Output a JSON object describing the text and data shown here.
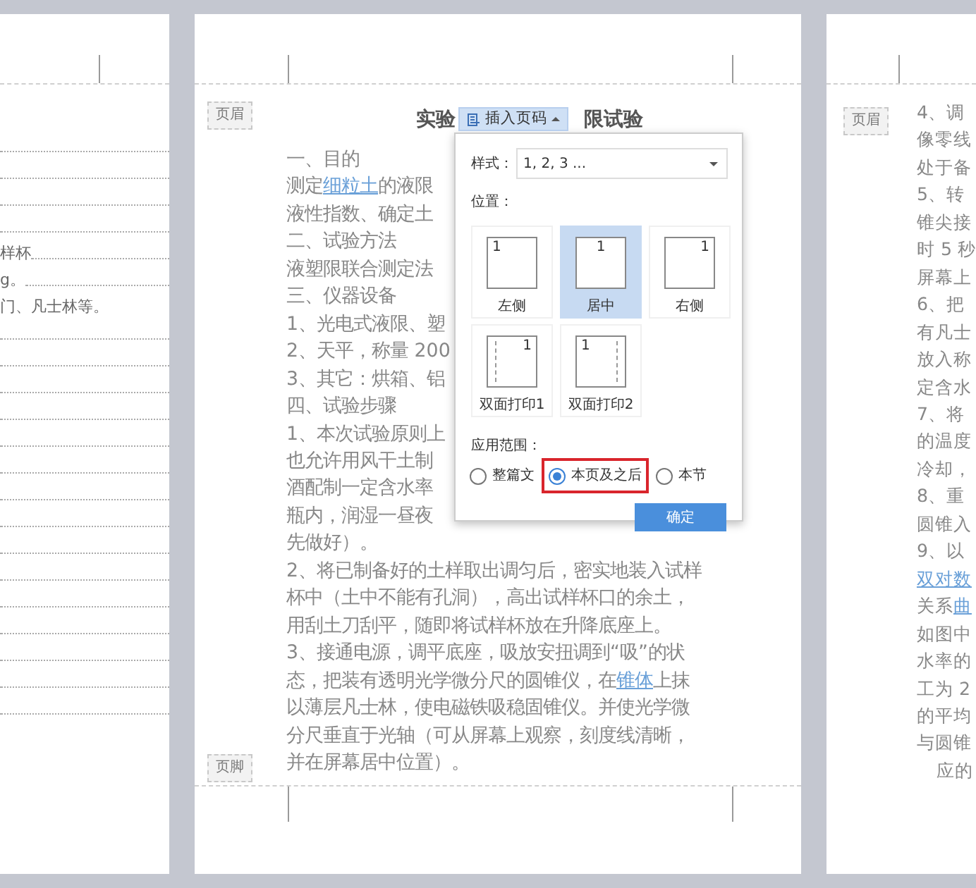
{
  "left_page": {
    "rows": [
      {
        "kind": "leader"
      },
      {
        "kind": "leader"
      },
      {
        "kind": "leader"
      },
      {
        "kind": "leader"
      },
      {
        "kind": "leader",
        "text": "样杯"
      },
      {
        "kind": "leader",
        "text": "g。"
      },
      {
        "kind": "text",
        "text": "门、凡士林等。"
      },
      {
        "kind": "leader"
      },
      {
        "kind": "leader"
      },
      {
        "kind": "leader"
      },
      {
        "kind": "leader"
      },
      {
        "kind": "leader"
      },
      {
        "kind": "leader"
      },
      {
        "kind": "leader"
      },
      {
        "kind": "leader"
      },
      {
        "kind": "leader"
      },
      {
        "kind": "leader"
      },
      {
        "kind": "leader"
      },
      {
        "kind": "leader"
      },
      {
        "kind": "leader"
      },
      {
        "kind": "leader"
      },
      {
        "kind": "leader"
      }
    ]
  },
  "middle_page": {
    "header_tag": "页眉",
    "footer_tag": "页脚",
    "title_parts": [
      "实验",
      "限试验"
    ],
    "lines": [
      {
        "segments": [
          {
            "text": "一、目的"
          }
        ]
      },
      {
        "segments": [
          {
            "text": "测定"
          },
          {
            "text": "细粒土",
            "link": true
          },
          {
            "text": "的液限"
          }
        ]
      },
      {
        "segments": [
          {
            "text": "液性指数、确定土"
          }
        ]
      },
      {
        "segments": [
          {
            "text": "二、试验方法"
          }
        ]
      },
      {
        "segments": [
          {
            "text": "液塑限联合测定法"
          }
        ]
      },
      {
        "segments": [
          {
            "text": "三、仪器设备"
          }
        ]
      },
      {
        "segments": [
          {
            "text": "1、光电式液限、塑"
          }
        ]
      },
      {
        "segments": [
          {
            "text": "2、天平，称量 200"
          }
        ]
      },
      {
        "segments": [
          {
            "text": "3、其它：烘箱、铝"
          }
        ]
      },
      {
        "segments": [
          {
            "text": "四、试验步骤"
          }
        ]
      },
      {
        "segments": [
          {
            "text": "1、本次试验原则上"
          }
        ]
      },
      {
        "segments": [
          {
            "text": "也允许用风干土制"
          }
        ]
      },
      {
        "segments": [
          {
            "text": "酒配制一定含水率"
          }
        ]
      },
      {
        "segments": [
          {
            "text": "瓶内，润湿一昼夜"
          }
        ]
      },
      {
        "segments": [
          {
            "text": "先做好）。"
          }
        ]
      },
      {
        "segments": [
          {
            "text": "2、将已制备好的土样取出调匀后，密实地装入试样"
          }
        ]
      },
      {
        "segments": [
          {
            "text": "杯中（土中不能有孔洞），高出试样杯口的余土，"
          }
        ]
      },
      {
        "segments": [
          {
            "text": "用刮土刀刮平，随即将试样杯放在升降底座上。"
          }
        ]
      },
      {
        "segments": [
          {
            "text": "3、接通电源，调平底座，吸放安扭调到“吸”的状"
          }
        ]
      },
      {
        "segments": [
          {
            "text": "态，把装有透明光学微分尺的圆锥仪，在"
          },
          {
            "text": "锥体",
            "link": true
          },
          {
            "text": "上抹"
          }
        ]
      },
      {
        "segments": [
          {
            "text": "以薄层凡士林，使电磁铁吸稳固锥仪。并使光学微"
          }
        ]
      },
      {
        "segments": [
          {
            "text": "分尺垂直于光轴（可从屏幕上观察，刻度线清晰，"
          }
        ]
      },
      {
        "segments": [
          {
            "text": "并在屏幕居中位置）。"
          }
        ]
      }
    ]
  },
  "dialog": {
    "trigger": "插入页码",
    "style_label": "样式：",
    "style_value": "1, 2, 3 ...",
    "position_label": "位置：",
    "positions": [
      {
        "kind": "left",
        "number": "1",
        "label": "左侧",
        "selected": false
      },
      {
        "kind": "center",
        "number": "1",
        "label": "居中",
        "selected": true
      },
      {
        "kind": "right",
        "number": "1",
        "label": "右侧",
        "selected": false
      },
      {
        "kind": "duplex1",
        "number": "1",
        "label": "双面打印1",
        "selected": false
      },
      {
        "kind": "duplex2",
        "number": "1",
        "label": "双面打印2",
        "selected": false
      }
    ],
    "scope_label": "应用范围：",
    "scope_options": [
      {
        "label": "整篇文",
        "selected": false,
        "highlighted": false
      },
      {
        "label": "本页及之后",
        "selected": true,
        "highlighted": true
      },
      {
        "label": "本节",
        "selected": false,
        "highlighted": false
      }
    ],
    "confirm": "确定"
  },
  "right_page": {
    "header_tag": "页眉",
    "lines": [
      {
        "segments": [
          {
            "text": "4、调"
          }
        ]
      },
      {
        "segments": [
          {
            "text": "像零线"
          }
        ]
      },
      {
        "segments": [
          {
            "text": "处于备"
          }
        ]
      },
      {
        "segments": [
          {
            "text": "5、转"
          }
        ]
      },
      {
        "segments": [
          {
            "text": "锥尖接"
          }
        ]
      },
      {
        "segments": [
          {
            "text": "时 5 秒"
          }
        ]
      },
      {
        "segments": [
          {
            "text": "屏幕上"
          }
        ]
      },
      {
        "segments": [
          {
            "text": "6、把"
          }
        ]
      },
      {
        "segments": [
          {
            "text": "有凡士"
          }
        ]
      },
      {
        "segments": [
          {
            "text": "放入称"
          }
        ]
      },
      {
        "segments": [
          {
            "text": "定含水"
          }
        ]
      },
      {
        "segments": [
          {
            "text": "7、将"
          }
        ]
      },
      {
        "segments": [
          {
            "text": "的温度"
          }
        ]
      },
      {
        "segments": [
          {
            "text": "冷却，"
          }
        ]
      },
      {
        "segments": [
          {
            "text": "8、重"
          }
        ]
      },
      {
        "segments": [
          {
            "text": "圆锥入"
          }
        ]
      },
      {
        "segments": [
          {
            "text": "9、以"
          }
        ]
      },
      {
        "segments": [
          {
            "text": "双对数",
            "link": true
          }
        ]
      },
      {
        "segments": [
          {
            "text": "关系"
          },
          {
            "text": "曲",
            "link": true
          }
        ]
      },
      {
        "segments": [
          {
            "text": "如图中"
          }
        ]
      },
      {
        "segments": [
          {
            "text": "水率的"
          }
        ]
      },
      {
        "segments": [
          {
            "text": "工为 2"
          }
        ]
      },
      {
        "segments": [
          {
            "text": "的平均"
          }
        ]
      },
      {
        "segments": [
          {
            "text": "与圆锥"
          }
        ]
      },
      {
        "segments": [
          {
            "text": "应的"
          }
        ],
        "indent": true
      }
    ]
  }
}
